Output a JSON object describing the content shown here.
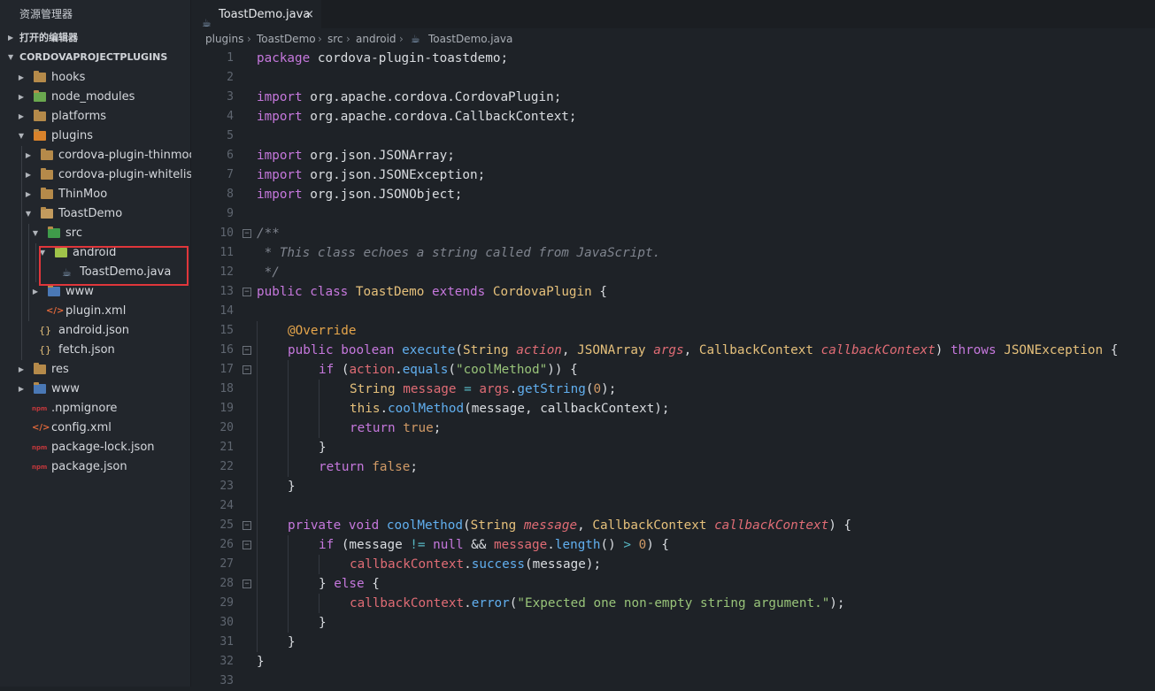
{
  "sidebar": {
    "title": "资源管理器",
    "open_editors": "打开的编辑器",
    "project": "CORDOVAPROJECTPLUGINS",
    "items": [
      {
        "label": "hooks"
      },
      {
        "label": "node_modules"
      },
      {
        "label": "platforms"
      },
      {
        "label": "plugins"
      },
      {
        "label": "cordova-plugin-thinmoo"
      },
      {
        "label": "cordova-plugin-whitelist"
      },
      {
        "label": "ThinMoo"
      },
      {
        "label": "ToastDemo"
      },
      {
        "label": "src"
      },
      {
        "label": "android"
      },
      {
        "label": "ToastDemo.java"
      },
      {
        "label": "www"
      },
      {
        "label": "plugin.xml"
      },
      {
        "label": "android.json"
      },
      {
        "label": "fetch.json"
      },
      {
        "label": "res"
      },
      {
        "label": "www"
      },
      {
        "label": ".npmignore"
      },
      {
        "label": "config.xml"
      },
      {
        "label": "package-lock.json"
      },
      {
        "label": "package.json"
      }
    ]
  },
  "tab": {
    "label": "ToastDemo.java",
    "close": "×"
  },
  "breadcrumb": [
    "plugins",
    "ToastDemo",
    "src",
    "android",
    "ToastDemo.java"
  ],
  "colors": {
    "highlight": "#e0363b",
    "keyword": "#c678dd",
    "string": "#98c379",
    "type": "#e5c07b",
    "function": "#61afef"
  },
  "line_numbers": [
    "1",
    "2",
    "3",
    "4",
    "5",
    "6",
    "7",
    "8",
    "9",
    "10",
    "11",
    "12",
    "13",
    "14",
    "15",
    "16",
    "17",
    "18",
    "19",
    "20",
    "21",
    "22",
    "23",
    "24",
    "25",
    "26",
    "27",
    "28",
    "29",
    "30",
    "31",
    "32",
    "33"
  ],
  "code": {
    "l1a": "package",
    "l1b": " cordova-plugin-toastdemo;",
    "l3a": "import",
    "l3b": " org.apache.cordova.CordovaPlugin;",
    "l4a": "import",
    "l4b": " org.apache.cordova.CallbackContext;",
    "l6a": "import",
    "l6b": " org.json.JSONArray;",
    "l7a": "import",
    "l7b": " org.json.JSONException;",
    "l8a": "import",
    "l8b": " org.json.JSONObject;",
    "l10": "/**",
    "l11": " * This class echoes a string called from JavaScript.",
    "l12": " */",
    "l13a": "public class",
    "l13b": " ToastDemo ",
    "l13c": "extends",
    "l13d": " CordovaPlugin",
    "l13e": " {",
    "l15": "@Override",
    "l16a": "public boolean",
    "l16b": " execute",
    "l16c": "(",
    "l16d": "String",
    "l16e": " action",
    "l16f": ", ",
    "l16g": "JSONArray",
    "l16h": " args",
    "l16i": ", ",
    "l16j": "CallbackContext",
    "l16k": " callbackContext",
    "l16l": ") ",
    "l16m": "throws",
    "l16n": " JSONException",
    "l16o": " {",
    "l17a": "if",
    "l17b": " (",
    "l17c": "action",
    "l17d": ".",
    "l17e": "equals",
    "l17f": "(",
    "l17g": "\"coolMethod\"",
    "l17h": ")) {",
    "l18a": "String",
    "l18b": " message",
    "l18c": " = ",
    "l18d": "args",
    "l18e": ".",
    "l18f": "getString",
    "l18g": "(",
    "l18h": "0",
    "l18i": ");",
    "l19a": "this",
    "l19b": ".",
    "l19c": "coolMethod",
    "l19d": "(message, callbackContext);",
    "l20a": "return",
    "l20b": " true",
    "l20c": ";",
    "l21": "}",
    "l22a": "return",
    "l22b": " false",
    "l22c": ";",
    "l23": "}",
    "l25a": "private void",
    "l25b": " coolMethod",
    "l25c": "(",
    "l25d": "String",
    "l25e": " message",
    "l25f": ", ",
    "l25g": "CallbackContext",
    "l25h": " callbackContext",
    "l25i": ") {",
    "l26a": "if",
    "l26b": " (message ",
    "l26c": "!=",
    "l26d": " null",
    "l26e": " && ",
    "l26f": "message",
    "l26g": ".",
    "l26h": "length",
    "l26i": "() ",
    "l26j": ">",
    "l26k": " 0",
    "l26l": ") {",
    "l27a": "callbackContext",
    "l27b": ".",
    "l27c": "success",
    "l27d": "(message);",
    "l28a": "} ",
    "l28b": "else",
    "l28c": " {",
    "l29a": "callbackContext",
    "l29b": ".",
    "l29c": "error",
    "l29d": "(",
    "l29e": "\"Expected one non-empty string argument.\"",
    "l29f": ");",
    "l30": "}",
    "l31": "}",
    "l32": "}"
  }
}
